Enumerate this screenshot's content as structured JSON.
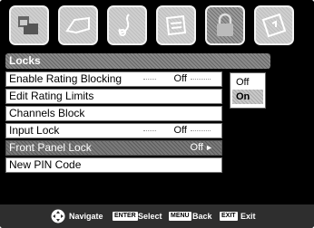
{
  "title": "Locks",
  "menu_items": [
    {
      "label": "Enable Rating Blocking",
      "value": "Off"
    },
    {
      "label": "Edit Rating Limits",
      "value": ""
    },
    {
      "label": "Channels Block",
      "value": ""
    },
    {
      "label": "Input Lock",
      "value": "Off"
    },
    {
      "label": "Front Panel Lock",
      "value": "Off"
    },
    {
      "label": "New PIN Code",
      "value": ""
    }
  ],
  "selected_index": 4,
  "popup_options": [
    "Off",
    "On"
  ],
  "popup_highlighted": "On",
  "footer": {
    "navigate": "Navigate",
    "enter_key": "ENTER",
    "select": "Select",
    "menu_key": "MENU",
    "back": "Back",
    "exit_key": "EXIT",
    "exit": "Exit"
  },
  "icons": [
    "picture-icon",
    "sound-icon",
    "music-icon",
    "setup-icon",
    "lock-icon",
    "application-icon"
  ],
  "active_icon": "lock-icon"
}
